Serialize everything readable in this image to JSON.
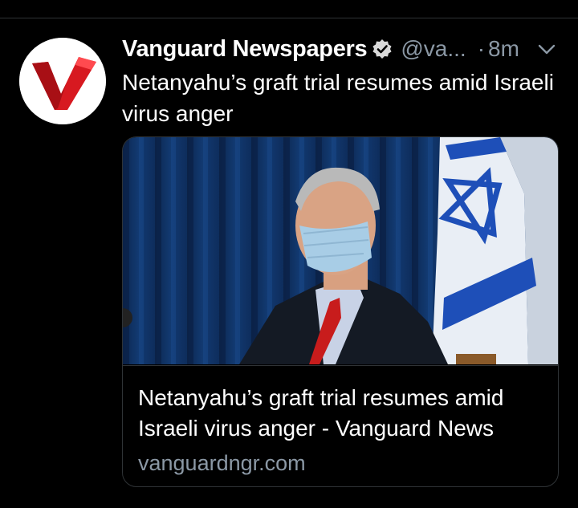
{
  "tweet": {
    "author_name": "Vanguard Newspapers",
    "handle": "@va...",
    "separator": "·",
    "time": "8m",
    "text": "Netanyahu’s graft trial resumes amid Israeli virus anger"
  },
  "card": {
    "title": "Netanyahu’s graft trial resumes amid Israeli virus anger - Vanguard News",
    "domain": "vanguardngr.com"
  },
  "icons": {
    "avatar": "vanguard-v-logo",
    "verified": "verified-badge-icon",
    "more": "chevron-down-icon"
  },
  "colors": {
    "background": "#000000",
    "secondary_text": "#8b98a5",
    "border": "#2f3336",
    "logo_red": "#d71920"
  }
}
